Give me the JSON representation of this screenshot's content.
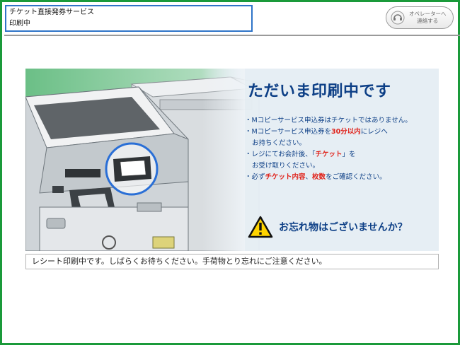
{
  "header": {
    "service_name": "チケット直接発券サービス",
    "status": "印刷中"
  },
  "operator_button": {
    "line1": "オペレーターへ",
    "line2": "連絡する"
  },
  "banner": {
    "title": "ただいま印刷中です",
    "bullet1": "・Mコピーサービス申込券はチケットではありません。",
    "bullet2_pre": "・Mコピーサービス申込券を",
    "bullet2_em": "30分以内",
    "bullet2_post": "にレジへ",
    "bullet2_cont": "お持ちください。",
    "bullet3_pre": "・レジにてお会計後、「",
    "bullet3_em": "チケット",
    "bullet3_post": "」を",
    "bullet3_cont": "お受け取りください。",
    "bullet4_pre": "・必ず",
    "bullet4_em1": "チケット内容",
    "bullet4_sep": "、",
    "bullet4_em2": "枚数",
    "bullet4_post": "をご確認ください。",
    "warning": "お忘れ物はございませんか？"
  },
  "status_message": "レシート印刷中です。しばらくお待ちください。手荷物とり忘れにご注意ください。",
  "colors": {
    "frame": "#1a9a3a",
    "header_border": "#2f74c8",
    "title_text": "#0d3f86",
    "emphasis": "#e0231b",
    "highlight_ring": "#2a6fd6"
  }
}
